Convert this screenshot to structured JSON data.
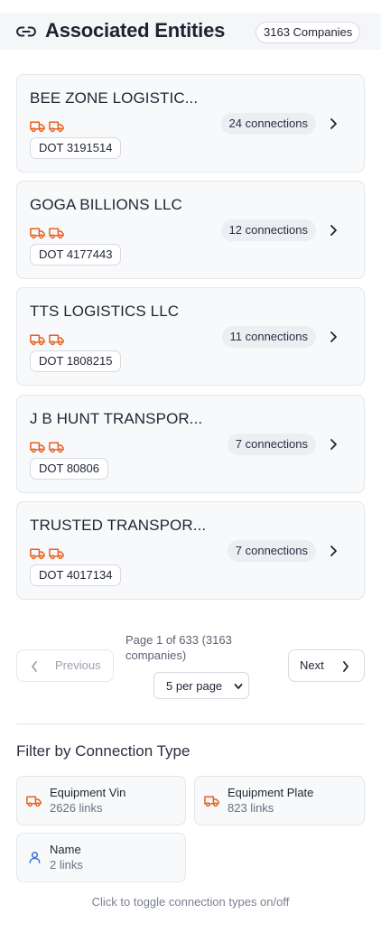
{
  "header": {
    "title": "Associated Entities",
    "company_count": "3163 Companies",
    "icon": "link-icon"
  },
  "entities": [
    {
      "name": "BEE ZONE LOGISTIC...",
      "dot": "DOT 3191514",
      "connections": "24 connections"
    },
    {
      "name": "GOGA BILLIONS LLC",
      "dot": "DOT 4177443",
      "connections": "12 connections"
    },
    {
      "name": "TTS LOGISTICS LLC",
      "dot": "DOT 1808215",
      "connections": "11 connections"
    },
    {
      "name": "J B HUNT TRANSPOR...",
      "dot": "DOT 80806",
      "connections": "7 connections"
    },
    {
      "name": "TRUSTED TRANSPOR...",
      "dot": "DOT 4017134",
      "connections": "7 connections"
    }
  ],
  "pagination": {
    "previous_label": "Previous",
    "next_label": "Next",
    "page_info": "Page 1 of 633 (3163 companies)",
    "per_page": "5 per page"
  },
  "filter": {
    "title": "Filter by Connection Type",
    "types": [
      {
        "label": "Equipment Vin",
        "count": "2626 links",
        "icon": "truck-icon"
      },
      {
        "label": "Equipment Plate",
        "count": "823 links",
        "icon": "truck-icon"
      },
      {
        "label": "Name",
        "count": "2 links",
        "icon": "person-icon"
      }
    ],
    "hint": "Click to toggle connection types on/off"
  },
  "colors": {
    "truck": "#e8601c",
    "person": "#3b6fd4",
    "text": "#1f2533",
    "muted": "#6b7280",
    "card_bg": "#f8f9fb",
    "border": "#e3e6ea"
  }
}
